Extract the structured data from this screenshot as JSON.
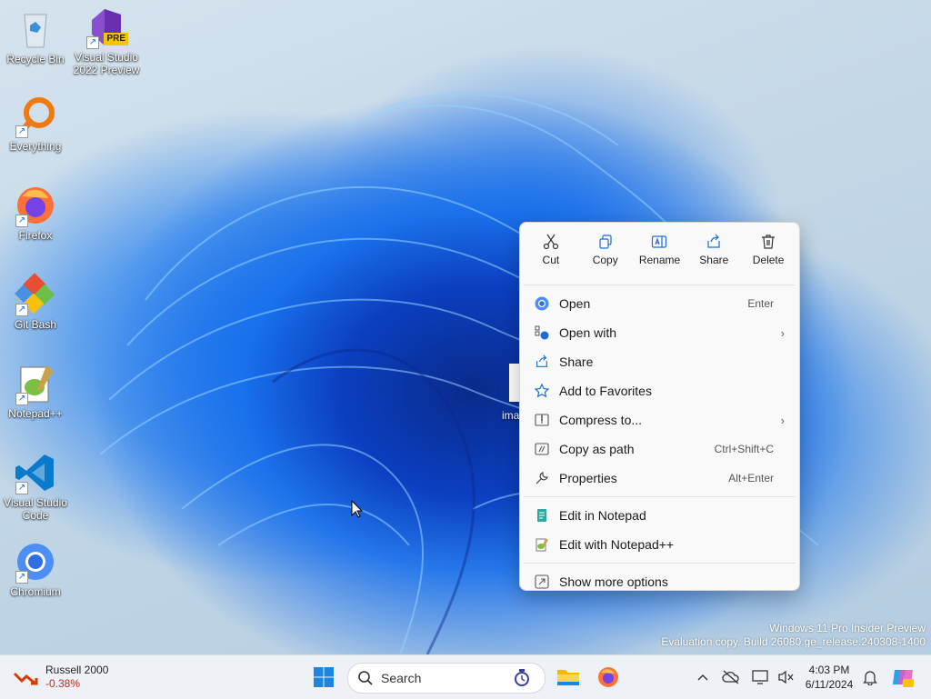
{
  "desktop": {
    "icons": [
      {
        "label": "Recycle Bin",
        "icon": "recycle-bin-icon"
      },
      {
        "label": "Visual Studio 2022 Preview",
        "label1": "Visual Studio",
        "label2": "2022 Preview",
        "badge": "PRE",
        "icon": "visual-studio-icon"
      },
      {
        "label": "Everything",
        "icon": "everything-search-icon"
      },
      {
        "label": "Firefox",
        "icon": "firefox-icon"
      },
      {
        "label": "Git Bash",
        "icon": "git-bash-icon"
      },
      {
        "label": "Notepad++",
        "icon": "notepad-plus-plus-icon"
      },
      {
        "label1": "Visual Studio",
        "label2": "Code",
        "icon": "vscode-icon"
      },
      {
        "label": "Chromium",
        "icon": "chromium-icon"
      }
    ],
    "partial_file_label": "ima"
  },
  "context_menu": {
    "quick_actions": [
      {
        "label": "Cut",
        "icon": "scissors-icon"
      },
      {
        "label": "Copy",
        "icon": "copy-icon"
      },
      {
        "label": "Rename",
        "icon": "rename-icon"
      },
      {
        "label": "Share",
        "icon": "share-icon"
      },
      {
        "label": "Delete",
        "icon": "trash-icon"
      }
    ],
    "items": [
      {
        "label": "Open",
        "shortcut": "Enter",
        "icon": "chromium-icon"
      },
      {
        "label": "Open with",
        "icon": "open-with-icon",
        "submenu": true
      },
      {
        "label": "Share",
        "icon": "share-icon"
      },
      {
        "label": "Add to Favorites",
        "icon": "star-icon"
      },
      {
        "label": "Compress to...",
        "icon": "zip-folder-icon",
        "submenu": true
      },
      {
        "label": "Copy as path",
        "shortcut": "Ctrl+Shift+C",
        "icon": "path-icon"
      },
      {
        "label": "Properties",
        "shortcut": "Alt+Enter",
        "icon": "wrench-icon"
      },
      {
        "label": "Edit in Notepad",
        "icon": "notepad-icon"
      },
      {
        "label": "Edit with Notepad++",
        "icon": "notepad-plus-plus-icon"
      },
      {
        "label": "Show more options",
        "icon": "more-options-icon"
      }
    ]
  },
  "watermark": {
    "line1": "Windows 11 Pro Insider Preview",
    "line2": "Evaluation copy. Build 26080.ge_release.240308-1400"
  },
  "taskbar": {
    "widget": {
      "title": "Russell 2000",
      "change": "-0.38%",
      "change_color": "#c42b1c"
    },
    "search_placeholder": "Search",
    "clock": {
      "time": "4:03 PM",
      "date": "6/11/2024"
    },
    "accent": "#0067c0"
  }
}
